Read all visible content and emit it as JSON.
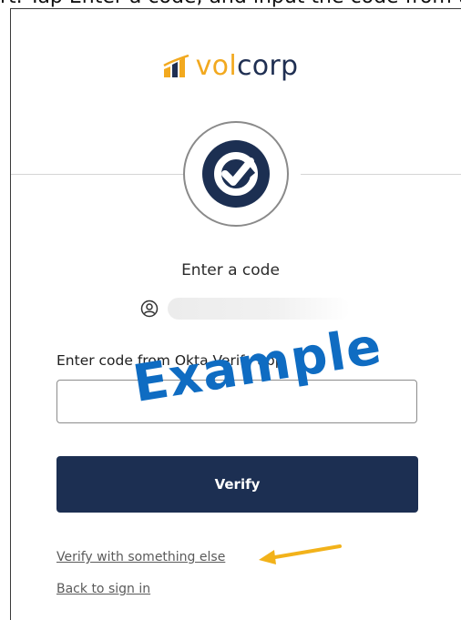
{
  "caption": "rt. Tap Enter a code, and input the code from the app ap",
  "brand": {
    "logo_vol": "vol",
    "logo_corp": "corp",
    "colors": {
      "gold": "#f2a91f",
      "navy": "#1f2f52",
      "button": "#1c2f52"
    }
  },
  "auth": {
    "badge_icon": "okta-verify-check-icon",
    "heading": "Enter a code",
    "user_icon": "user-circle-icon"
  },
  "form": {
    "field_label": "Enter code from Okta Verify app",
    "code_value": "",
    "submit_label": "Verify"
  },
  "watermark": "Example",
  "links": {
    "verify_else": "Verify with something else",
    "back": "Back to sign in"
  },
  "annotation": {
    "arrow_icon": "yellow-arrow-icon",
    "arrow_color": "#f2b21a"
  }
}
